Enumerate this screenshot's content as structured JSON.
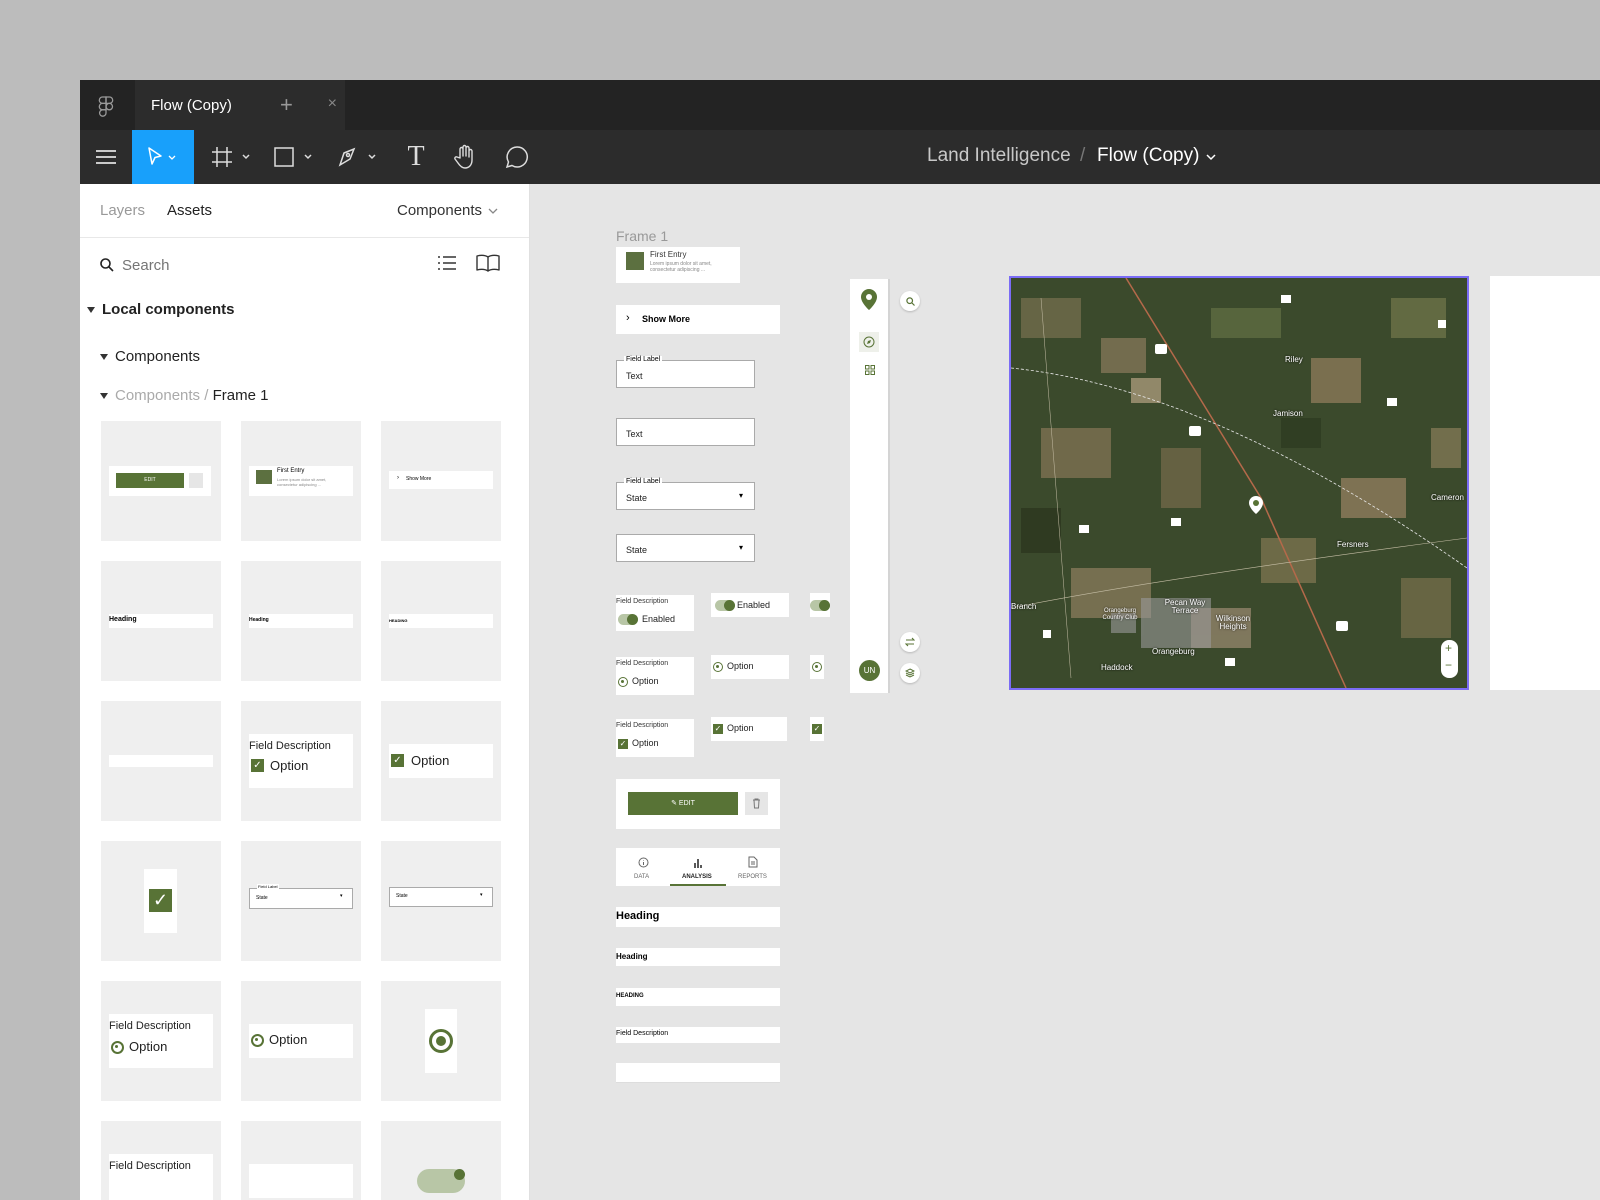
{
  "tabbar": {
    "tab_title": "Flow (Copy)",
    "close": "×",
    "add": "+"
  },
  "toolbar": {
    "project": "Land Intelligence",
    "separator": "/",
    "file": "Flow (Copy)",
    "text_tool": "T"
  },
  "sidebar": {
    "tabs": [
      "Layers",
      "Assets"
    ],
    "library": "Components",
    "search_placeholder": "Search",
    "local_components": "Local components",
    "components_group": "Components",
    "path_parent": "Components",
    "path_sep": "/",
    "path_current": "Frame 1"
  },
  "thumbs": {
    "edit": "EDIT",
    "first_entry": "First Entry",
    "lorem": "Lorem ipsum dolor sit amet, consectetur adipiscing ...",
    "show_more": "Show More",
    "heading": "Heading",
    "heading_caps": "HEADING",
    "field_description": "Field Description",
    "option": "Option",
    "field_label": "Field Label",
    "state": "State"
  },
  "canvas": {
    "frame_name": "Frame 1",
    "first_entry": "First Entry",
    "lorem": "Lorem ipsum dolor sit amet, consectetur adipiscing ...",
    "show_more": "Show More",
    "field_label": "Field Label",
    "text": "Text",
    "state": "State",
    "field_description": "Field Description",
    "enabled": "Enabled",
    "option": "Option",
    "edit": "EDIT",
    "tabs": [
      "DATA",
      "ANALYSIS",
      "REPORTS"
    ],
    "heading": "Heading",
    "heading_caps": "HEADING",
    "avatar": "UN"
  },
  "map": {
    "places": [
      "Riley",
      "Jamison",
      "Cameron",
      "Fersners",
      "Branch",
      "Orangeburg Country Club",
      "Pecan Way Terrace",
      "Wilkinson Heights",
      "Orangeburg",
      "Haddock"
    ],
    "zoom_in": "+",
    "zoom_out": "−"
  },
  "colors": {
    "accent": "#18a0fb",
    "brand_green": "#587336",
    "selection": "#7b6cf6"
  }
}
